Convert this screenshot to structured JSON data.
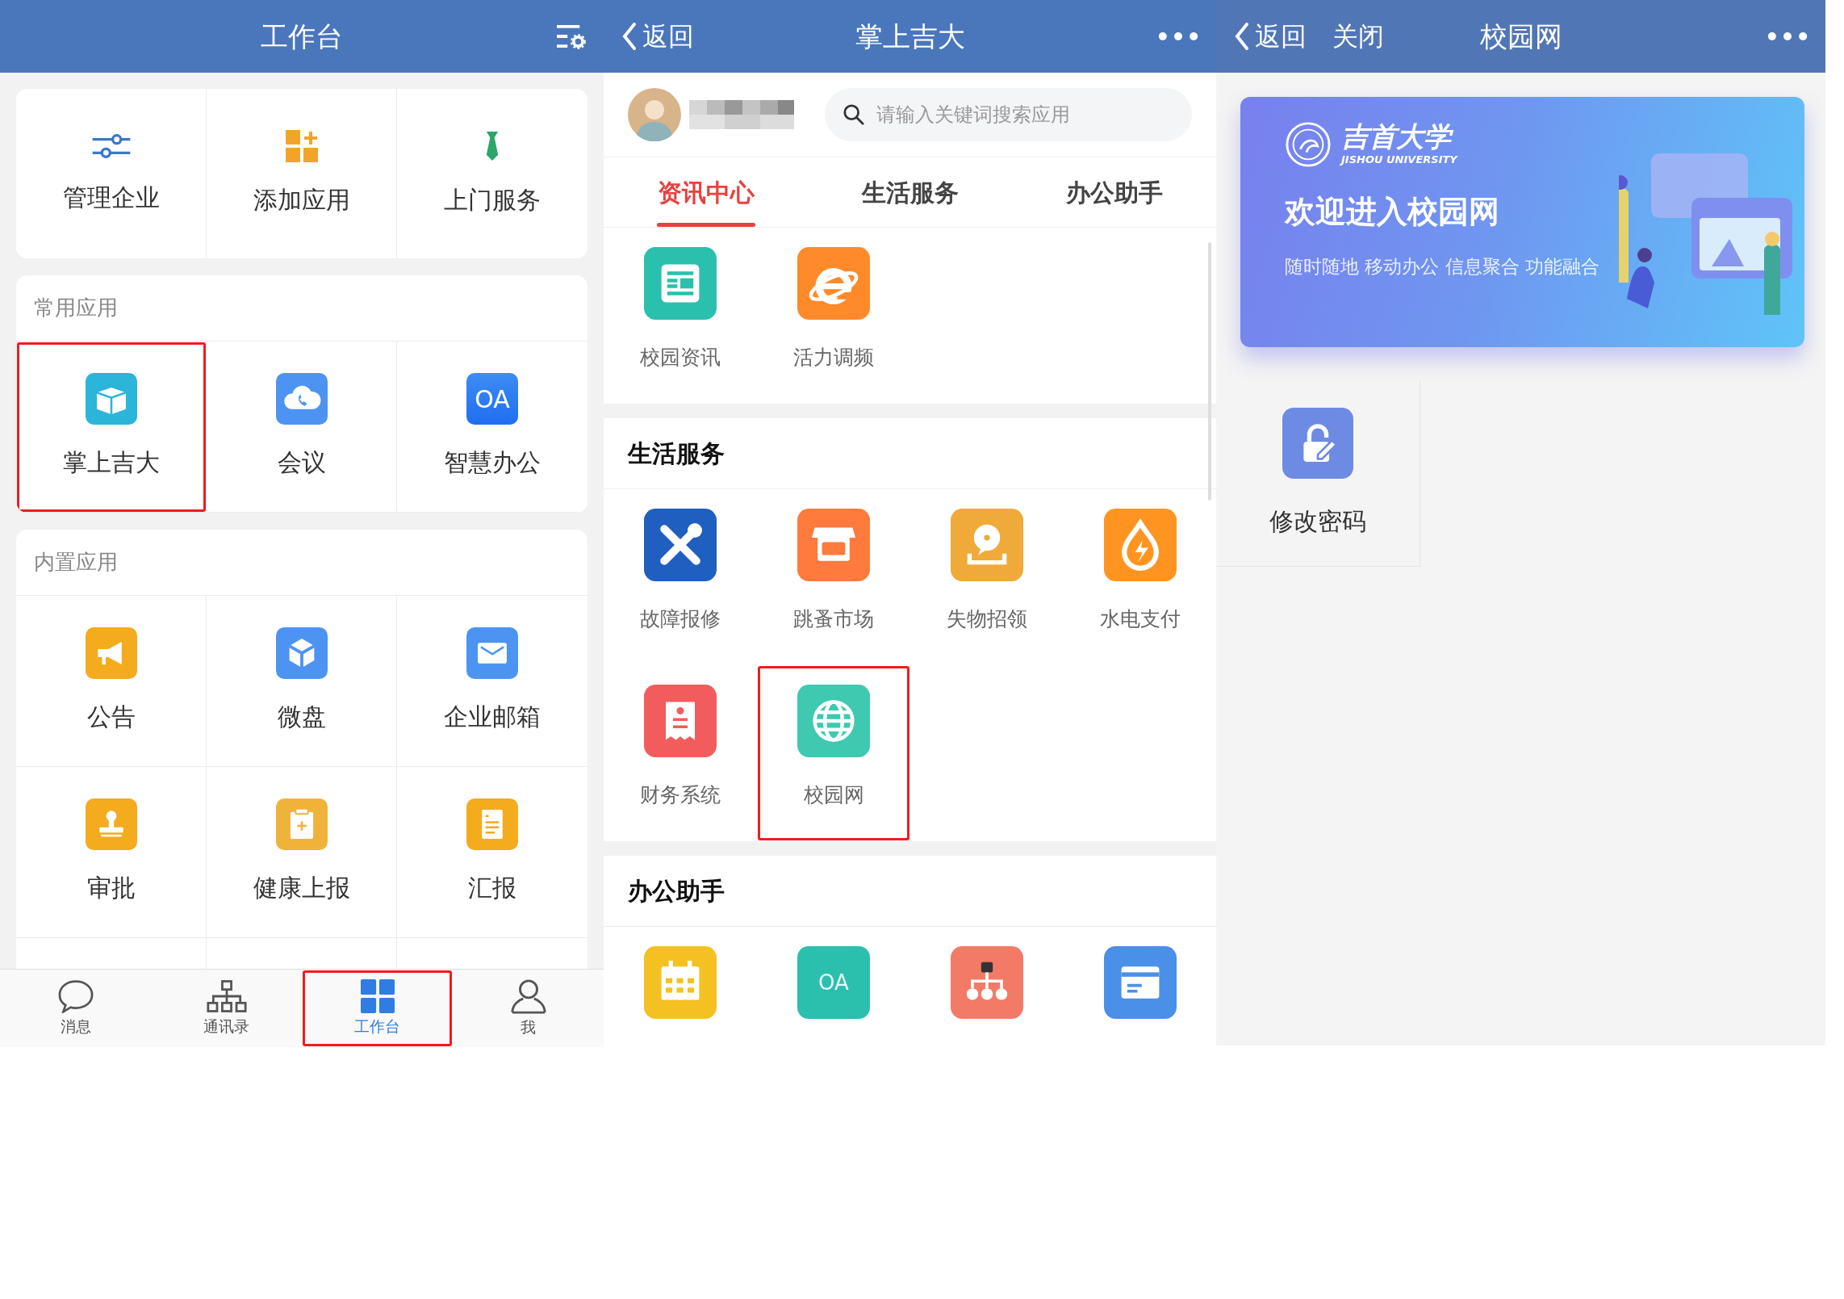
{
  "workbench": {
    "title": "工作台",
    "quick_actions": [
      {
        "label": "管理企业"
      },
      {
        "label": "添加应用"
      },
      {
        "label": "上门服务"
      }
    ],
    "sections": [
      {
        "title": "常用应用",
        "apps": [
          {
            "label": "掌上吉大",
            "highlighted": true
          },
          {
            "label": "会议",
            "highlighted": false
          },
          {
            "label": "智慧办公",
            "icon_text": "OA",
            "highlighted": false
          }
        ]
      },
      {
        "title": "内置应用",
        "apps": [
          {
            "label": "公告",
            "highlighted": false
          },
          {
            "label": "微盘",
            "highlighted": false
          },
          {
            "label": "企业邮箱",
            "highlighted": false
          },
          {
            "label": "审批",
            "highlighted": false
          },
          {
            "label": "健康上报",
            "highlighted": false
          },
          {
            "label": "汇报",
            "highlighted": false
          }
        ]
      }
    ],
    "tab_bar": [
      {
        "label": "消息",
        "selected": false,
        "highlighted": false
      },
      {
        "label": "通讯录",
        "selected": false,
        "highlighted": false
      },
      {
        "label": "工作台",
        "selected": true,
        "highlighted": true
      },
      {
        "label": "我",
        "selected": false,
        "highlighted": false
      }
    ]
  },
  "app_portal": {
    "back_label": "返回",
    "title": "掌上吉大",
    "search": {
      "placeholder": "请输入关键词搜索应用"
    },
    "tabs": [
      {
        "label": "资讯中心",
        "selected": true
      },
      {
        "label": "生活服务",
        "selected": false
      },
      {
        "label": "办公助手",
        "selected": false
      }
    ],
    "sections": [
      {
        "apps": [
          {
            "label": "校园资讯",
            "highlighted": false
          },
          {
            "label": "活力调频",
            "highlighted": false
          }
        ]
      },
      {
        "title": "生活服务",
        "apps": [
          {
            "label": "故障报修",
            "highlighted": false
          },
          {
            "label": "跳蚤市场",
            "highlighted": false
          },
          {
            "label": "失物招领",
            "highlighted": false
          },
          {
            "label": "水电支付",
            "highlighted": false
          },
          {
            "label": "财务系统",
            "highlighted": false
          },
          {
            "label": "校园网",
            "highlighted": true
          }
        ]
      },
      {
        "title": "办公助手",
        "apps": [
          {
            "highlighted": false
          },
          {
            "icon_text": "OA",
            "highlighted": false
          },
          {
            "highlighted": false
          },
          {
            "highlighted": false
          }
        ]
      }
    ]
  },
  "campus_net": {
    "back_label": "返回",
    "close_label": "关闭",
    "title": "校园网",
    "banner": {
      "logo_text": "吉首大学",
      "logo_subtitle": "JISHOU UNIVERSITY",
      "headline": "欢迎进入校园网",
      "tagline": "随时随地 移动办公 信息聚合 功能融合"
    },
    "apps": [
      {
        "label": "修改密码"
      }
    ]
  }
}
